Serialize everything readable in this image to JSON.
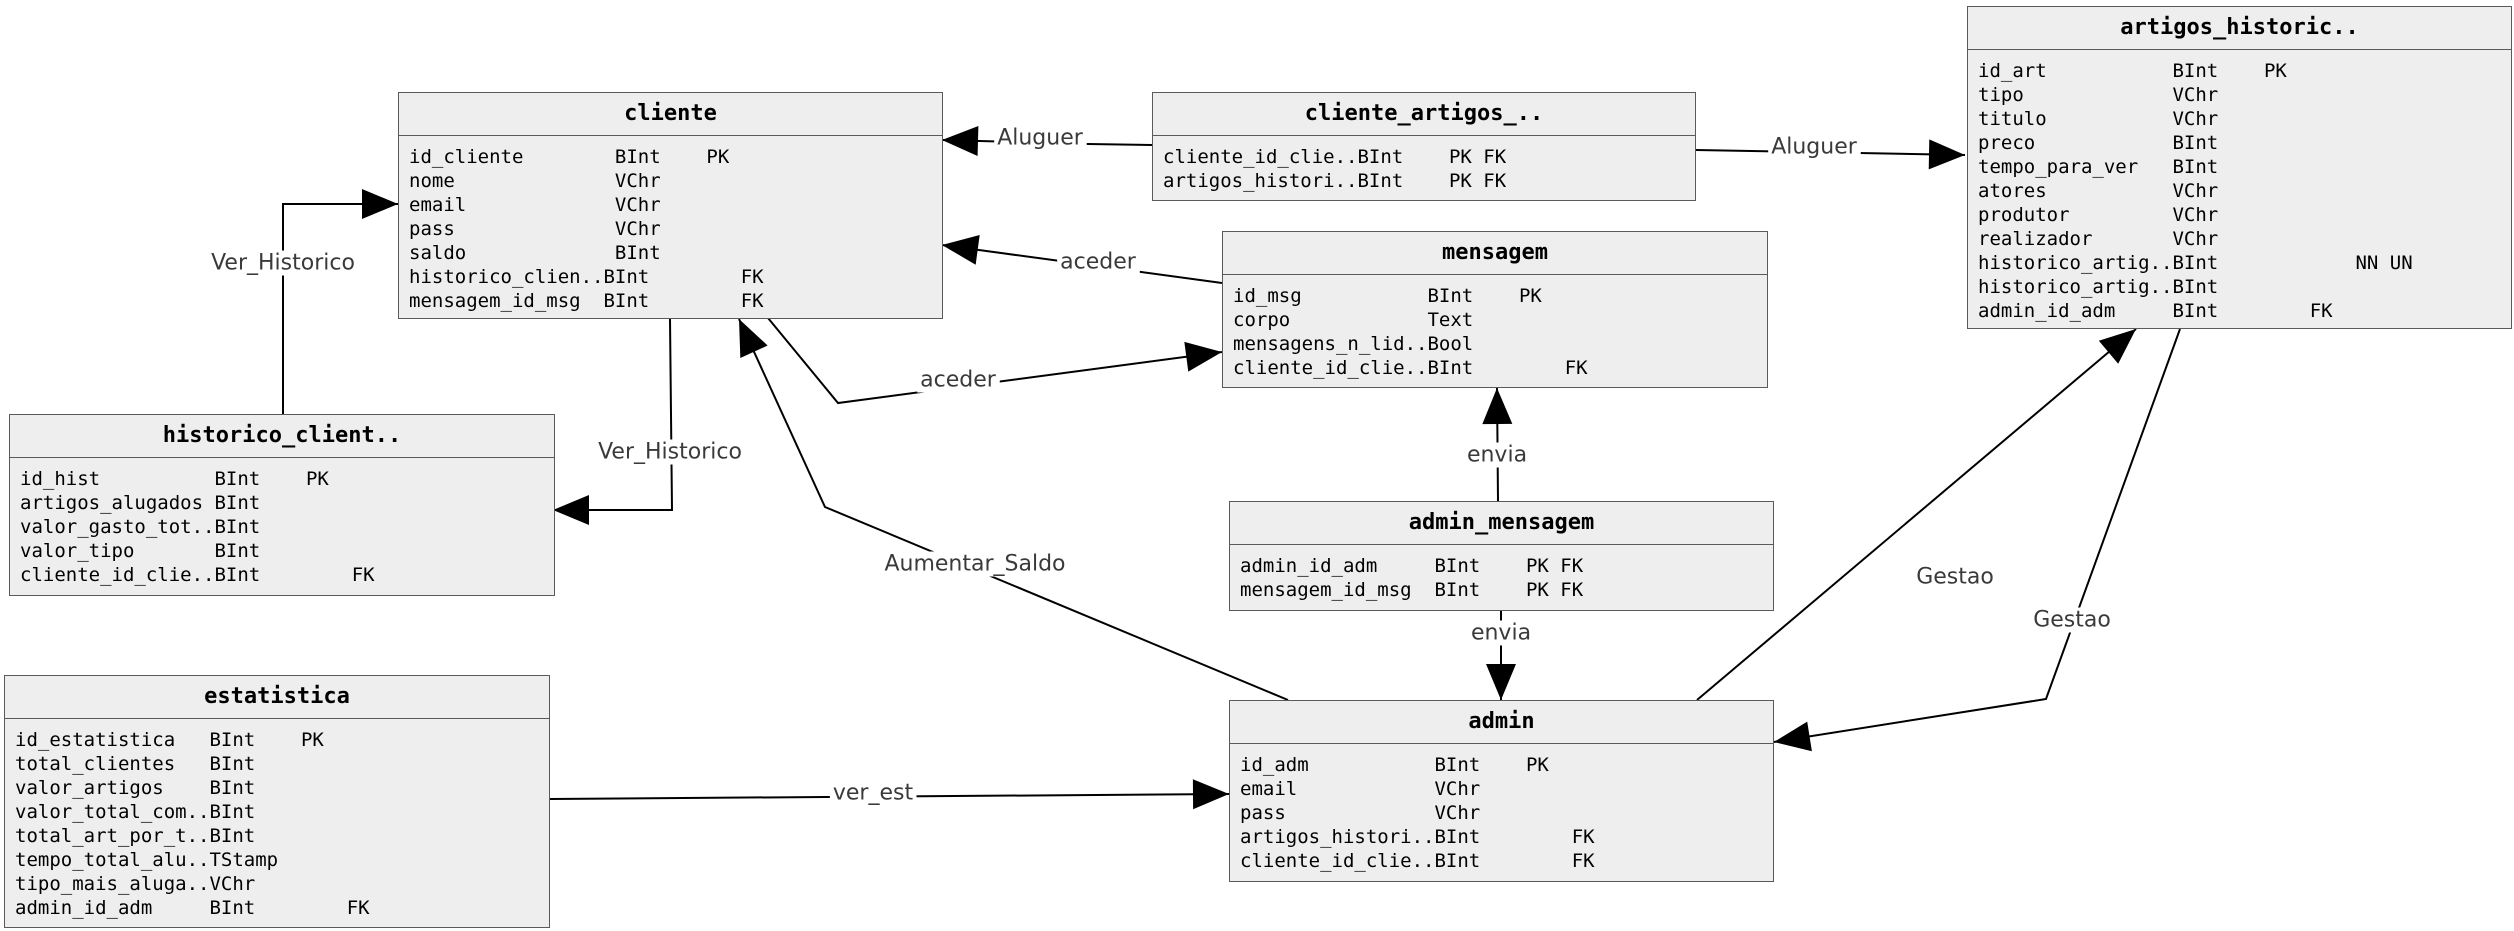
{
  "entities": {
    "cliente": {
      "name": "cliente",
      "rows": [
        "id_cliente        BInt    PK",
        "nome              VChr",
        "email             VChr",
        "pass              VChr",
        "saldo             BInt",
        "historico_clien..BInt        FK",
        "mensagem_id_msg  BInt        FK"
      ]
    },
    "cliente_artigos": {
      "name": "cliente_artigos_..",
      "rows": [
        "cliente_id_clie..BInt    PK FK",
        "artigos_histori..BInt    PK FK"
      ]
    },
    "artigos_historic": {
      "name": "artigos_historic..",
      "rows": [
        "id_art           BInt    PK",
        "tipo             VChr",
        "titulo           VChr",
        "preco            BInt",
        "tempo_para_ver   BInt",
        "atores           VChr",
        "produtor         VChr",
        "realizador       VChr",
        "historico_artig..BInt            NN UN",
        "historico_artig..BInt",
        "admin_id_adm     BInt        FK"
      ]
    },
    "mensagem": {
      "name": "mensagem",
      "rows": [
        "id_msg           BInt    PK",
        "corpo            Text",
        "mensagens_n_lid..Bool",
        "cliente_id_clie..BInt        FK"
      ]
    },
    "historico_client": {
      "name": "historico_client..",
      "rows": [
        "id_hist          BInt    PK",
        "artigos_alugados BInt",
        "valor_gasto_tot..BInt",
        "valor_tipo       BInt",
        "cliente_id_clie..BInt        FK"
      ]
    },
    "admin_mensagem": {
      "name": "admin_mensagem",
      "rows": [
        "admin_id_adm     BInt    PK FK",
        "mensagem_id_msg  BInt    PK FK"
      ]
    },
    "estatistica": {
      "name": "estatistica",
      "rows": [
        "id_estatistica   BInt    PK",
        "total_clientes   BInt",
        "valor_artigos    BInt",
        "valor_total_com..BInt",
        "total_art_por_t..BInt",
        "tempo_total_alu..TStamp",
        "tipo_mais_aluga..VChr",
        "admin_id_adm     BInt        FK"
      ]
    },
    "admin": {
      "name": "admin",
      "rows": [
        "id_adm           BInt    PK",
        "email            VChr",
        "pass             VChr",
        "artigos_histori..BInt        FK",
        "cliente_id_clie..BInt        FK"
      ]
    }
  },
  "relations": {
    "aluguer_cliente": "Aluguer",
    "aluguer_artigos": "Aluguer",
    "aceder_mensagem_cliente": "aceder",
    "aceder_cliente_mensagem": "aceder",
    "ver_historico_up": "Ver_Historico",
    "ver_historico_down": "Ver_Historico",
    "aumentar_saldo": "Aumentar_Saldo",
    "envia_up": "envia",
    "envia_down": "envia",
    "gestao_up": "Gestao",
    "gestao_down": "Gestao",
    "ver_est": "ver_est"
  }
}
